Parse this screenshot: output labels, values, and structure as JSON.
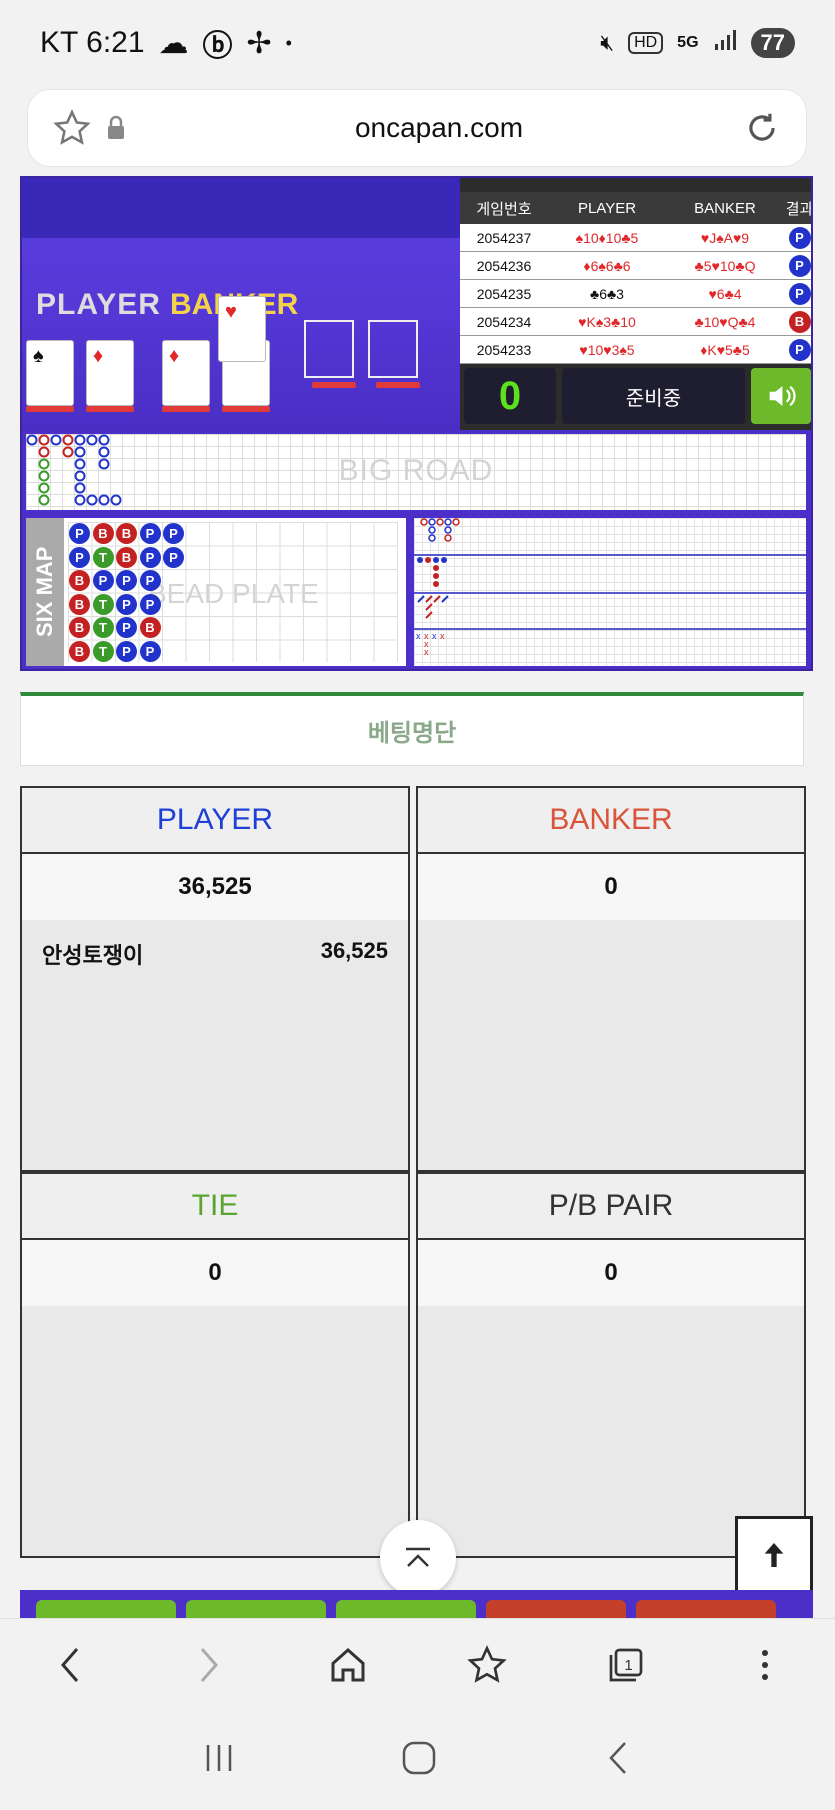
{
  "status_bar": {
    "carrier_time": "KT 6:21",
    "battery": "77",
    "hd": "HD",
    "network": "5G"
  },
  "browser": {
    "url": "oncapan.com"
  },
  "game": {
    "video": {
      "player_label": "PLAYER",
      "banker_label": "BANKER"
    },
    "results_table": {
      "headers": [
        "게임번호",
        "PLAYER",
        "BANKER",
        "결과"
      ],
      "rows": [
        {
          "id": "2054237",
          "player": "♠10♦10♣5",
          "banker": "♥J♠A♥9",
          "result": "P"
        },
        {
          "id": "2054236",
          "player": "♦6♠6♣6",
          "banker": "♣5♥10♣Q",
          "result": "P"
        },
        {
          "id": "2054235",
          "player": "♣6♣3",
          "banker": "♥6♣4",
          "result": "P"
        },
        {
          "id": "2054234",
          "player": "♥K♠3♣10",
          "banker": "♣10♥Q♣4",
          "result": "B"
        },
        {
          "id": "2054233",
          "player": "♥10♥3♠5",
          "banker": "♦K♥5♣5",
          "result": "P"
        }
      ]
    },
    "countdown": "0",
    "round_status": "준비중",
    "big_road_label": "BIG ROAD",
    "six_map_label": "SIX MAP",
    "bead_plate_label": "BEAD PLATE",
    "bead_plate": [
      [
        "P",
        "B",
        "B",
        "P",
        "P"
      ],
      [
        "P",
        "T",
        "B",
        "P",
        "P"
      ],
      [
        "B",
        "P",
        "P",
        "P"
      ],
      [
        "B",
        "T",
        "P",
        "P"
      ],
      [
        "B",
        "T",
        "P",
        "B"
      ],
      [
        "B",
        "T",
        "P",
        "P"
      ]
    ]
  },
  "betting": {
    "title": "베팅명단",
    "panels": [
      {
        "name": "PLAYER",
        "total": "36,525",
        "entries": [
          {
            "user": "안성토쟁이",
            "amount": "36,525"
          }
        ]
      },
      {
        "name": "BANKER",
        "total": "0",
        "entries": []
      },
      {
        "name": "TIE",
        "total": "0",
        "entries": []
      },
      {
        "name": "P/B PAIR",
        "total": "0",
        "entries": []
      }
    ]
  }
}
